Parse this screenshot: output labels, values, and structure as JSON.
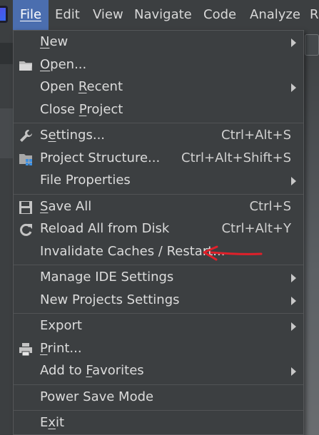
{
  "menubar": {
    "items": [
      {
        "label": "File",
        "mnemonic_index": 0,
        "active": true
      },
      {
        "label": "Edit",
        "mnemonic_index": 0,
        "active": false
      },
      {
        "label": "View",
        "mnemonic_index": 0,
        "active": false
      },
      {
        "label": "Navigate",
        "mnemonic_index": 0,
        "active": false
      },
      {
        "label": "Code",
        "mnemonic_index": 0,
        "active": false
      },
      {
        "label": "Analyze",
        "mnemonic_index": 5,
        "active": false
      },
      {
        "label": "R",
        "mnemonic_index": -1,
        "active": false
      }
    ]
  },
  "file_menu": {
    "groups": [
      [
        {
          "label": "New",
          "u": 0,
          "icon": "",
          "shortcut": "",
          "submenu": true
        },
        {
          "label": "Open...",
          "u": 0,
          "icon": "folder-icon",
          "shortcut": "",
          "submenu": false
        },
        {
          "label": "Open Recent",
          "u": 5,
          "icon": "",
          "shortcut": "",
          "submenu": true
        },
        {
          "label": "Close Project",
          "u": 6,
          "icon": "",
          "shortcut": "",
          "submenu": false
        }
      ],
      [
        {
          "label": "Settings...",
          "u": 1,
          "icon": "wrench-icon",
          "shortcut": "Ctrl+Alt+S",
          "submenu": false
        },
        {
          "label": "Project Structure...",
          "u": -1,
          "icon": "project-structure-icon",
          "shortcut": "Ctrl+Alt+Shift+S",
          "submenu": false
        },
        {
          "label": "File Properties",
          "u": -1,
          "icon": "",
          "shortcut": "",
          "submenu": true
        }
      ],
      [
        {
          "label": "Save All",
          "u": 0,
          "icon": "save-icon",
          "shortcut": "Ctrl+S",
          "submenu": false
        },
        {
          "label": "Reload All from Disk",
          "u": -1,
          "icon": "reload-icon",
          "shortcut": "Ctrl+Alt+Y",
          "submenu": false
        },
        {
          "label": "Invalidate Caches / Restart...",
          "u": -1,
          "icon": "",
          "shortcut": "",
          "submenu": false
        }
      ],
      [
        {
          "label": "Manage IDE Settings",
          "u": -1,
          "icon": "",
          "shortcut": "",
          "submenu": true
        },
        {
          "label": "New Projects Settings",
          "u": -1,
          "icon": "",
          "shortcut": "",
          "submenu": true
        }
      ],
      [
        {
          "label": "Export",
          "u": -1,
          "icon": "",
          "shortcut": "",
          "submenu": true
        },
        {
          "label": "Print...",
          "u": 0,
          "icon": "printer-icon",
          "shortcut": "",
          "submenu": false
        },
        {
          "label": "Add to Favorites",
          "u": 7,
          "icon": "",
          "shortcut": "",
          "submenu": true
        }
      ],
      [
        {
          "label": "Power Save Mode",
          "u": -1,
          "icon": "",
          "shortcut": "",
          "submenu": false
        }
      ],
      [
        {
          "label": "Exit",
          "u": 1,
          "icon": "",
          "shortcut": "",
          "submenu": false
        }
      ]
    ]
  },
  "colors": {
    "menu_bg": "#3c3f41",
    "active_title_bg": "#4b6eaf",
    "text": "#dcdcdc",
    "annotation": "#e0202a"
  }
}
